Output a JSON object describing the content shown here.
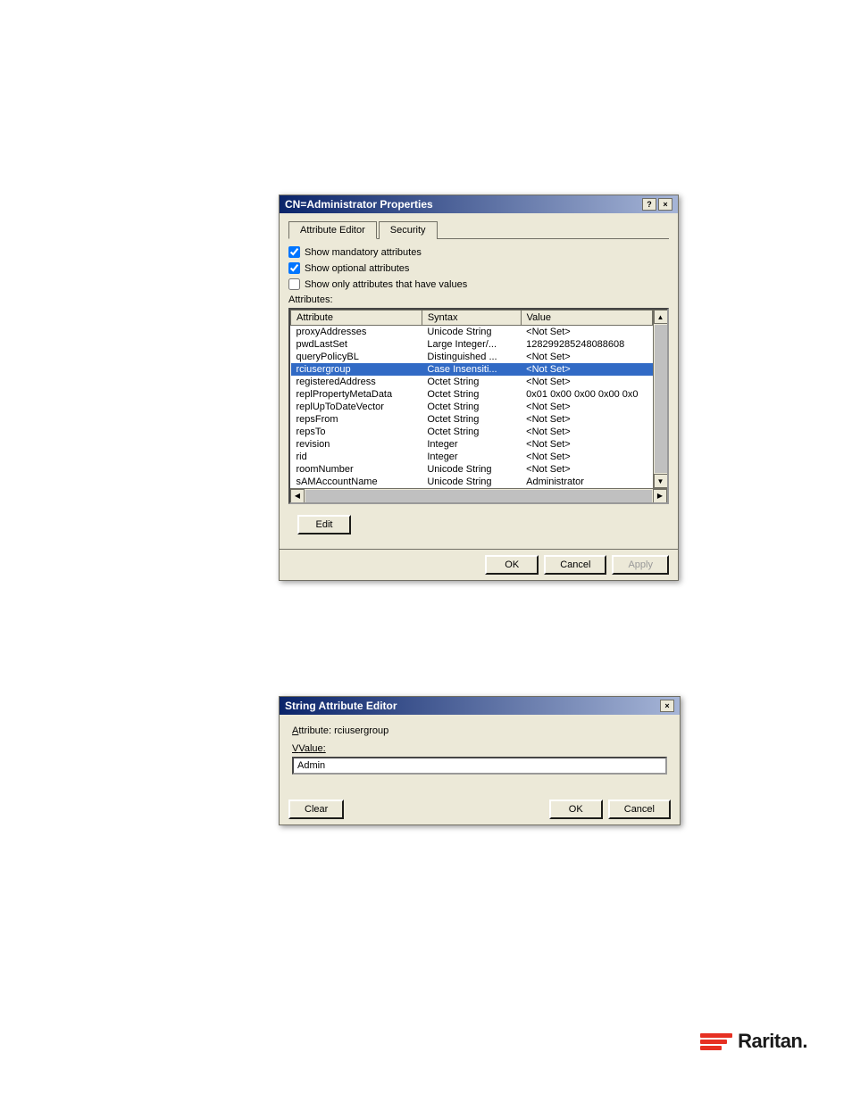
{
  "cn_dialog": {
    "title": "CN=Administrator Properties",
    "tabs": [
      {
        "label": "Attribute Editor",
        "active": true
      },
      {
        "label": "Security",
        "active": false
      }
    ],
    "checkboxes": [
      {
        "id": "cb1",
        "label": "Show mandatory attributes",
        "checked": true
      },
      {
        "id": "cb2",
        "label": "Show optional attributes",
        "checked": true
      },
      {
        "id": "cb3",
        "label": "Show only attributes that have values",
        "checked": false
      }
    ],
    "attributes_label": "Attributes:",
    "table": {
      "headers": [
        "Attribute",
        "Syntax",
        "Value"
      ],
      "rows": [
        {
          "attribute": "proxyAddresses",
          "syntax": "Unicode String",
          "value": "<Not Set>",
          "selected": false
        },
        {
          "attribute": "pwdLastSet",
          "syntax": "Large Integer/...",
          "value": "128299285248088608",
          "selected": false
        },
        {
          "attribute": "queryPolicyBL",
          "syntax": "Distinguished ...",
          "value": "<Not Set>",
          "selected": false
        },
        {
          "attribute": "rciusergroup",
          "syntax": "Case Insensiti...",
          "value": "<Not Set>",
          "selected": true
        },
        {
          "attribute": "registeredAddress",
          "syntax": "Octet String",
          "value": "<Not Set>",
          "selected": false
        },
        {
          "attribute": "replPropertyMetaData",
          "syntax": "Octet String",
          "value": "0x01 0x00 0x00 0x00 0x0",
          "selected": false
        },
        {
          "attribute": "replUpToDateVector",
          "syntax": "Octet String",
          "value": "<Not Set>",
          "selected": false
        },
        {
          "attribute": "repsFrom",
          "syntax": "Octet String",
          "value": "<Not Set>",
          "selected": false
        },
        {
          "attribute": "repsTo",
          "syntax": "Octet String",
          "value": "<Not Set>",
          "selected": false
        },
        {
          "attribute": "revision",
          "syntax": "Integer",
          "value": "<Not Set>",
          "selected": false
        },
        {
          "attribute": "rid",
          "syntax": "Integer",
          "value": "<Not Set>",
          "selected": false
        },
        {
          "attribute": "roomNumber",
          "syntax": "Unicode String",
          "value": "<Not Set>",
          "selected": false
        },
        {
          "attribute": "sAMAccountName",
          "syntax": "Unicode String",
          "value": "Administrator",
          "selected": false
        }
      ]
    },
    "edit_button": "Edit",
    "ok_button": "OK",
    "cancel_button": "Cancel",
    "apply_button": "Apply",
    "help_icon": "?",
    "close_icon": "×"
  },
  "str_dialog": {
    "title": "String Attribute Editor",
    "attribute_label": "Attribute:",
    "attribute_value": "rciusergroup",
    "value_label": "Value:",
    "value_input": "Admin",
    "clear_button": "Clear",
    "ok_button": "OK",
    "cancel_button": "Cancel",
    "close_icon": "×"
  },
  "raritan": {
    "text": "Raritan.",
    "icon_colors": [
      "#e63022",
      "#e63022",
      "#e63022"
    ]
  }
}
